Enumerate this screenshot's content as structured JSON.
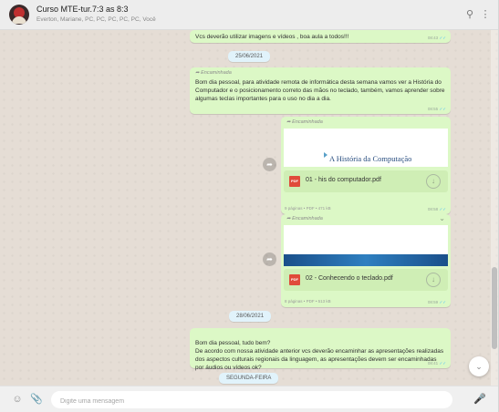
{
  "header": {
    "title": "Curso MTE-tur.7:3 as 8:3",
    "participants": "Everton, Mariane, PC, PC, PC, PC, PC, Você",
    "search_icon": "search-icon",
    "menu_icon": "menu-icon"
  },
  "messages": {
    "m1": {
      "text": "Vcs deverão utilizar imagens e  vídeos , boa aula a todos!!!",
      "time": "08:43"
    },
    "date1": "25/06/2021",
    "m2": {
      "forwarded": "Encaminhada",
      "text": "Bom dia pessoal, para atividade remota de informática desta semana vamos ver a História do Computador e o posicionamento correto das mãos no teclado, também, vamos aprender sobre algumas teclas importantes para o uso no dia a dia.",
      "time": "08:55"
    },
    "doc1": {
      "forwarded": "Encaminhada",
      "thumb_title": "A História da Computação",
      "file_name": "01 - his do computador.pdf",
      "meta": "9 páginas • PDF • 471 kB",
      "time": "08:58",
      "badge": "PDF"
    },
    "doc2": {
      "forwarded": "Encaminhada",
      "file_name": "02 - Conhecendo o teclado.pdf",
      "meta": "8 páginas • PDF • 513 kB",
      "time": "08:59",
      "badge": "PDF"
    },
    "date2": "28/06/2021",
    "m3": {
      "text": "Bom dia pessoal, tudo bem?\nDe acordo com nossa atividade anterior vcs deverão encaminhar as apresentações realizadas dos aspectos culturais regionais da linguagem, as apresentações devem ser encaminhadas por áudios ou vídeos ok?",
      "time": "08:41"
    },
    "date3": "SEGUNDA-FEIRA"
  },
  "footer": {
    "placeholder": "Digite uma mensagem",
    "emoji_icon": "emoji-icon",
    "attach_icon": "attach-icon",
    "mic_icon": "microphone-icon"
  },
  "colors": {
    "bubble_out": "#dcf8c6",
    "chat_bg": "#e5ddd5",
    "pdf_red": "#e04b3a",
    "read_tick": "#4fc3f7"
  }
}
